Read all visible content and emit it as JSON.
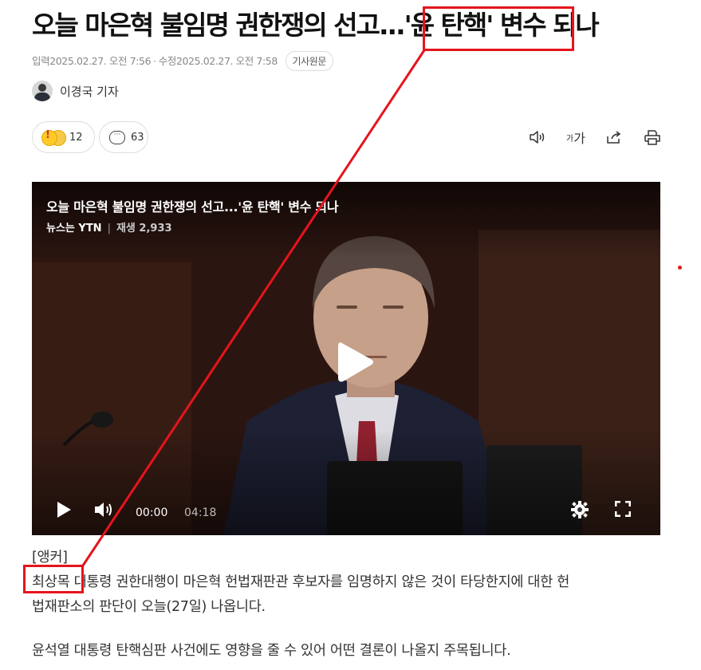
{
  "article": {
    "title": "오늘 마은혁 불임명 권한쟁의 선고...'윤 탄핵' 변수 되나",
    "published": "입력2025.02.27. 오전 7:56",
    "modified": "수정2025.02.27. 오전 7:58",
    "original_button": "기사원문",
    "author": "이경국 기자"
  },
  "reactions": {
    "count": "12",
    "comments": "63"
  },
  "toolbar": {
    "icons": [
      "speaker-icon",
      "font-size-icon",
      "share-icon",
      "print-icon"
    ],
    "font_label": "가"
  },
  "video": {
    "title": "오늘 마은혁 불임명 권한쟁의 선고...'윤 탄핵' 변수 되나",
    "source": "뉴스는 YTN",
    "views": "재생 2,933",
    "current_time": "00:00",
    "total_time": "04:18"
  },
  "body": {
    "tag": "[앵커]",
    "para1_line1": "최상목 대통령 권한대행이 마은혁 헌법재판관 후보자를 임명하지 않은 것이 타당한지에 대한 헌",
    "para1_line2": "법재판소의 판단이 오늘(27일) 나옵니다.",
    "para2": "윤석열 대통령 탄핵심판 사건에도 영향을 줄 수 있어 어떤 결론이 나올지 주목됩니다."
  },
  "colors": {
    "annotation": "#e6141c",
    "text": "#222222"
  }
}
